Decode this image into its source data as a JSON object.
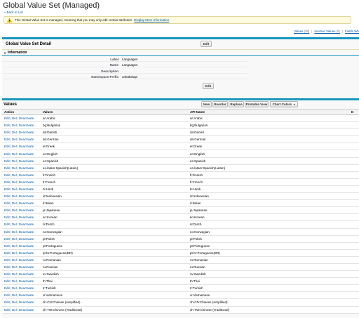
{
  "header": {
    "title": "Global Value Set (Managed)",
    "back_link": "Back to List",
    "back_arrow": "«"
  },
  "notice": {
    "icon": "warning-icon",
    "message": "This Global Value Set is managed, meaning that you may only edit certain attributes.",
    "more_link": "Display More Information"
  },
  "related_links": [
    {
      "label": "Values",
      "count": "[38]"
    },
    {
      "label": "Inactive Values",
      "count": "[0]"
    },
    {
      "label": "Fields Wh",
      "count": ""
    }
  ],
  "detail": {
    "title": "Global Value Set Detail",
    "edit_label": "Edit",
    "section_title": "Information",
    "section_toggle": "▼",
    "fields": [
      {
        "label": "Label",
        "value": "Languages"
      },
      {
        "label": "Name",
        "value": "Languages"
      },
      {
        "label": "Description",
        "value": ""
      },
      {
        "label": "Namespace Prefix",
        "value": "unbabelapi"
      }
    ]
  },
  "values_section": {
    "title": "Values",
    "buttons": {
      "new": "New",
      "reorder": "Reorder",
      "replace": "Replace",
      "printable": "Printable View",
      "chart_colors": "Chart Colors"
    },
    "columns": [
      "Action",
      "Values",
      "API Name",
      "D"
    ],
    "action_links": {
      "edit": "Edit",
      "del": "Del",
      "deactivate": "Deactivate",
      "sep": "|"
    },
    "rows": [
      {
        "value": "ar:Arabic",
        "api": "ar:Arabic"
      },
      {
        "value": "bg:Bulgarian",
        "api": "bg:Bulgarian"
      },
      {
        "value": "da:Danish",
        "api": "da:Danish"
      },
      {
        "value": "de:German",
        "api": "de:German"
      },
      {
        "value": "el:Greek",
        "api": "el:Greek"
      },
      {
        "value": "en:English",
        "api": "en:English"
      },
      {
        "value": "es:Spanish",
        "api": "es:Spanish"
      },
      {
        "value": "es-latam:Spanish(Latam)",
        "api": "es-latam:Spanish(Latam)"
      },
      {
        "value": "fi:Finnish",
        "api": "fi:Finnish"
      },
      {
        "value": "fr:French",
        "api": "fr:French"
      },
      {
        "value": "hi:Hindi",
        "api": "hi:Hindi"
      },
      {
        "value": "id:Indonesian",
        "api": "id:Indonesian"
      },
      {
        "value": "it:Italian",
        "api": "it:Italian"
      },
      {
        "value": "ja:Japanese",
        "api": "ja:Japanese"
      },
      {
        "value": "ko:Korean",
        "api": "ko:Korean"
      },
      {
        "value": "nl:Dutch",
        "api": "nl:Dutch"
      },
      {
        "value": "no:Norwegian",
        "api": "no:Norwegian"
      },
      {
        "value": "pl:Polish",
        "api": "pl:Polish"
      },
      {
        "value": "pt:Portuguese",
        "api": "pt:Portuguese"
      },
      {
        "value": "pt-br:Portuguese(BR)",
        "api": "pt-br:Portuguese(BR)"
      },
      {
        "value": "ro:Romanian",
        "api": "ro:Romanian"
      },
      {
        "value": "ru:Russian",
        "api": "ru:Russian"
      },
      {
        "value": "sv:Swedish",
        "api": "sv:Swedish"
      },
      {
        "value": "th:Thai",
        "api": "th:Thai"
      },
      {
        "value": "tr:Turkish",
        "api": "tr:Turkish"
      },
      {
        "value": "vi:Vietnamese",
        "api": "vi:Vietnamese"
      },
      {
        "value": "zh-CN:Chinese (simplified)",
        "api": "zh-CN:Chinese (simplified)"
      },
      {
        "value": "zh-TW:Chinese (Traditional)",
        "api": "zh-TW:Chinese (Traditional)"
      }
    ]
  }
}
